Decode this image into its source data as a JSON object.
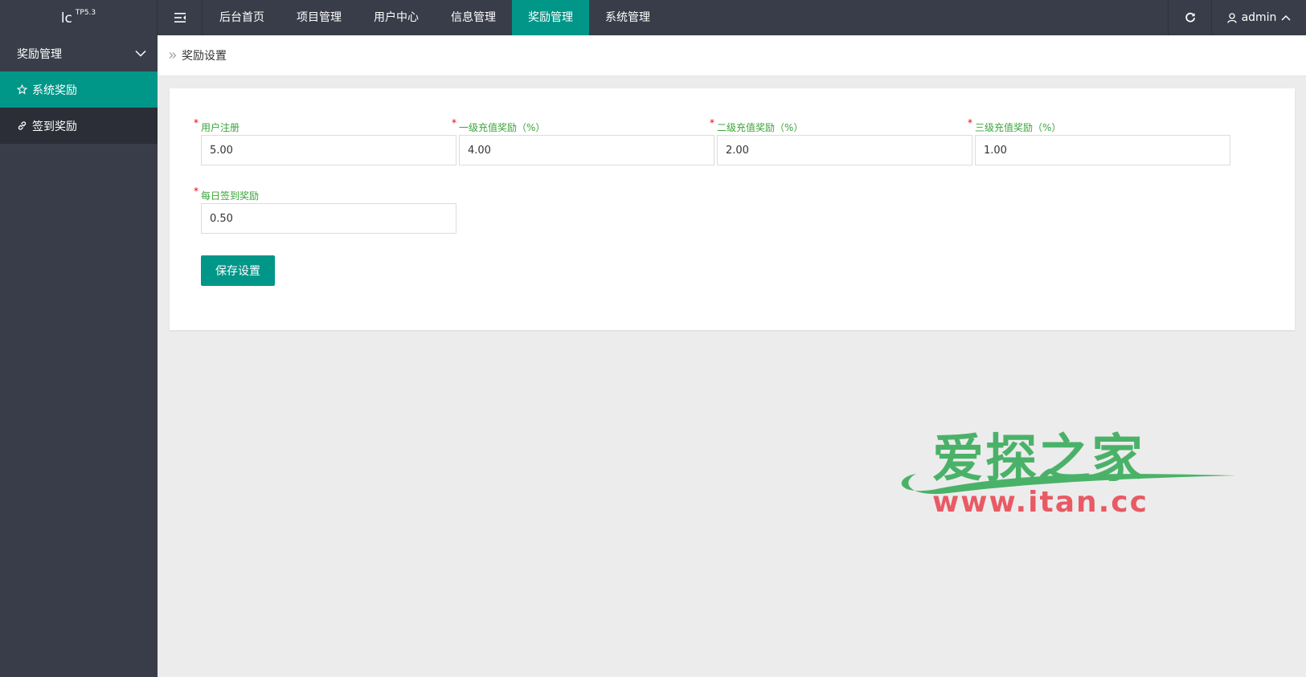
{
  "header": {
    "logo_main": "lc",
    "logo_sup": "TP5.3",
    "nav": [
      {
        "label": "后台首页"
      },
      {
        "label": "项目管理"
      },
      {
        "label": "用户中心"
      },
      {
        "label": "信息管理"
      },
      {
        "label": "奖励管理"
      },
      {
        "label": "系统管理"
      }
    ],
    "active_nav": "奖励管理",
    "user_name": "admin",
    "accent_color": "#009688",
    "bar_color": "#393d49"
  },
  "sidebar": {
    "group_label": "奖励管理",
    "items": [
      {
        "label": "系统奖励",
        "icon": "star-icon"
      },
      {
        "label": "签到奖励",
        "icon": "link-icon"
      }
    ],
    "active_item": "系统奖励"
  },
  "breadcrumb": {
    "current": "奖励设置"
  },
  "form": {
    "fields": [
      {
        "label": "用户注册",
        "value": "5.00"
      },
      {
        "label": "一级充值奖励（%）",
        "value": "4.00"
      },
      {
        "label": "二级充值奖励（%）",
        "value": "2.00"
      },
      {
        "label": "三级充值奖励（%）",
        "value": "1.00"
      },
      {
        "label": "每日签到奖励",
        "value": "0.50"
      }
    ],
    "required_mark": "*",
    "save_label": "保存设置"
  },
  "watermark": {
    "text_cn": "爱探之家",
    "text_url": "www.itan.cc"
  }
}
